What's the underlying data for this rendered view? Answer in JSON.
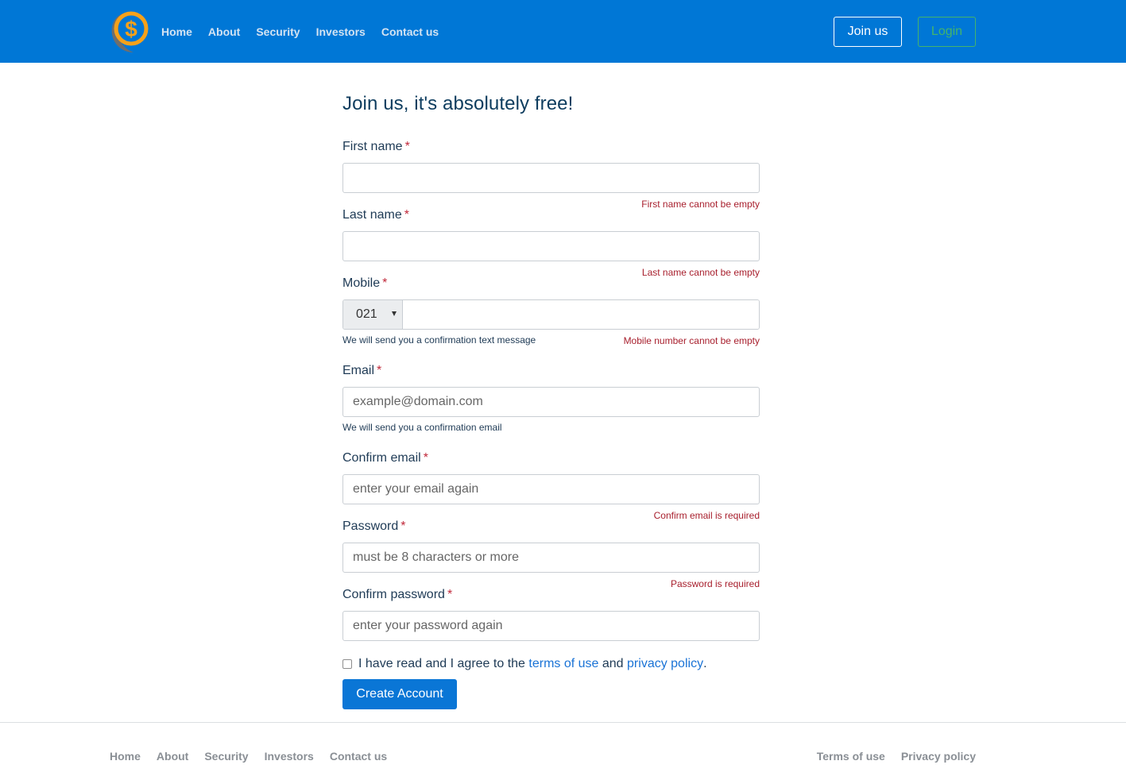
{
  "header": {
    "logo_icon": "dollar-coin-logo-icon",
    "nav": [
      "Home",
      "About",
      "Security",
      "Investors",
      "Contact us"
    ],
    "join_label": "Join us",
    "login_label": "Login",
    "colors": {
      "bar": "#0077d6",
      "login": "#44b46b"
    }
  },
  "form": {
    "title": "Join us, it's absolutely free!",
    "required_mark": "*",
    "first_name": {
      "label": "First name",
      "value": "",
      "error": "First name cannot be empty"
    },
    "last_name": {
      "label": "Last name",
      "value": "",
      "error": "Last name cannot be empty"
    },
    "mobile": {
      "label": "Mobile",
      "prefix": "021",
      "value": "",
      "hint": "We will send you a confirmation text message",
      "error": "Mobile number cannot be empty"
    },
    "email": {
      "label": "Email",
      "placeholder": "example@domain.com",
      "hint": "We will send you a confirmation email"
    },
    "confirm_email": {
      "label": "Confirm email",
      "placeholder": "enter your email again",
      "error": "Confirm email is required"
    },
    "password": {
      "label": "Password",
      "placeholder": "must be 8 characters or more",
      "error": "Password is required"
    },
    "confirm_password": {
      "label": "Confirm password",
      "placeholder": "enter your password again"
    },
    "agree": {
      "checked": false,
      "text_before": "I have read and I agree to the",
      "terms": "terms of use",
      "and": "and",
      "privacy": "privacy policy",
      "end": "."
    },
    "submit_label": "Create Account"
  },
  "footer": {
    "nav": [
      "Home",
      "About",
      "Security",
      "Investors",
      "Contact us"
    ],
    "legal": [
      "Terms of use",
      "Privacy policy"
    ]
  }
}
